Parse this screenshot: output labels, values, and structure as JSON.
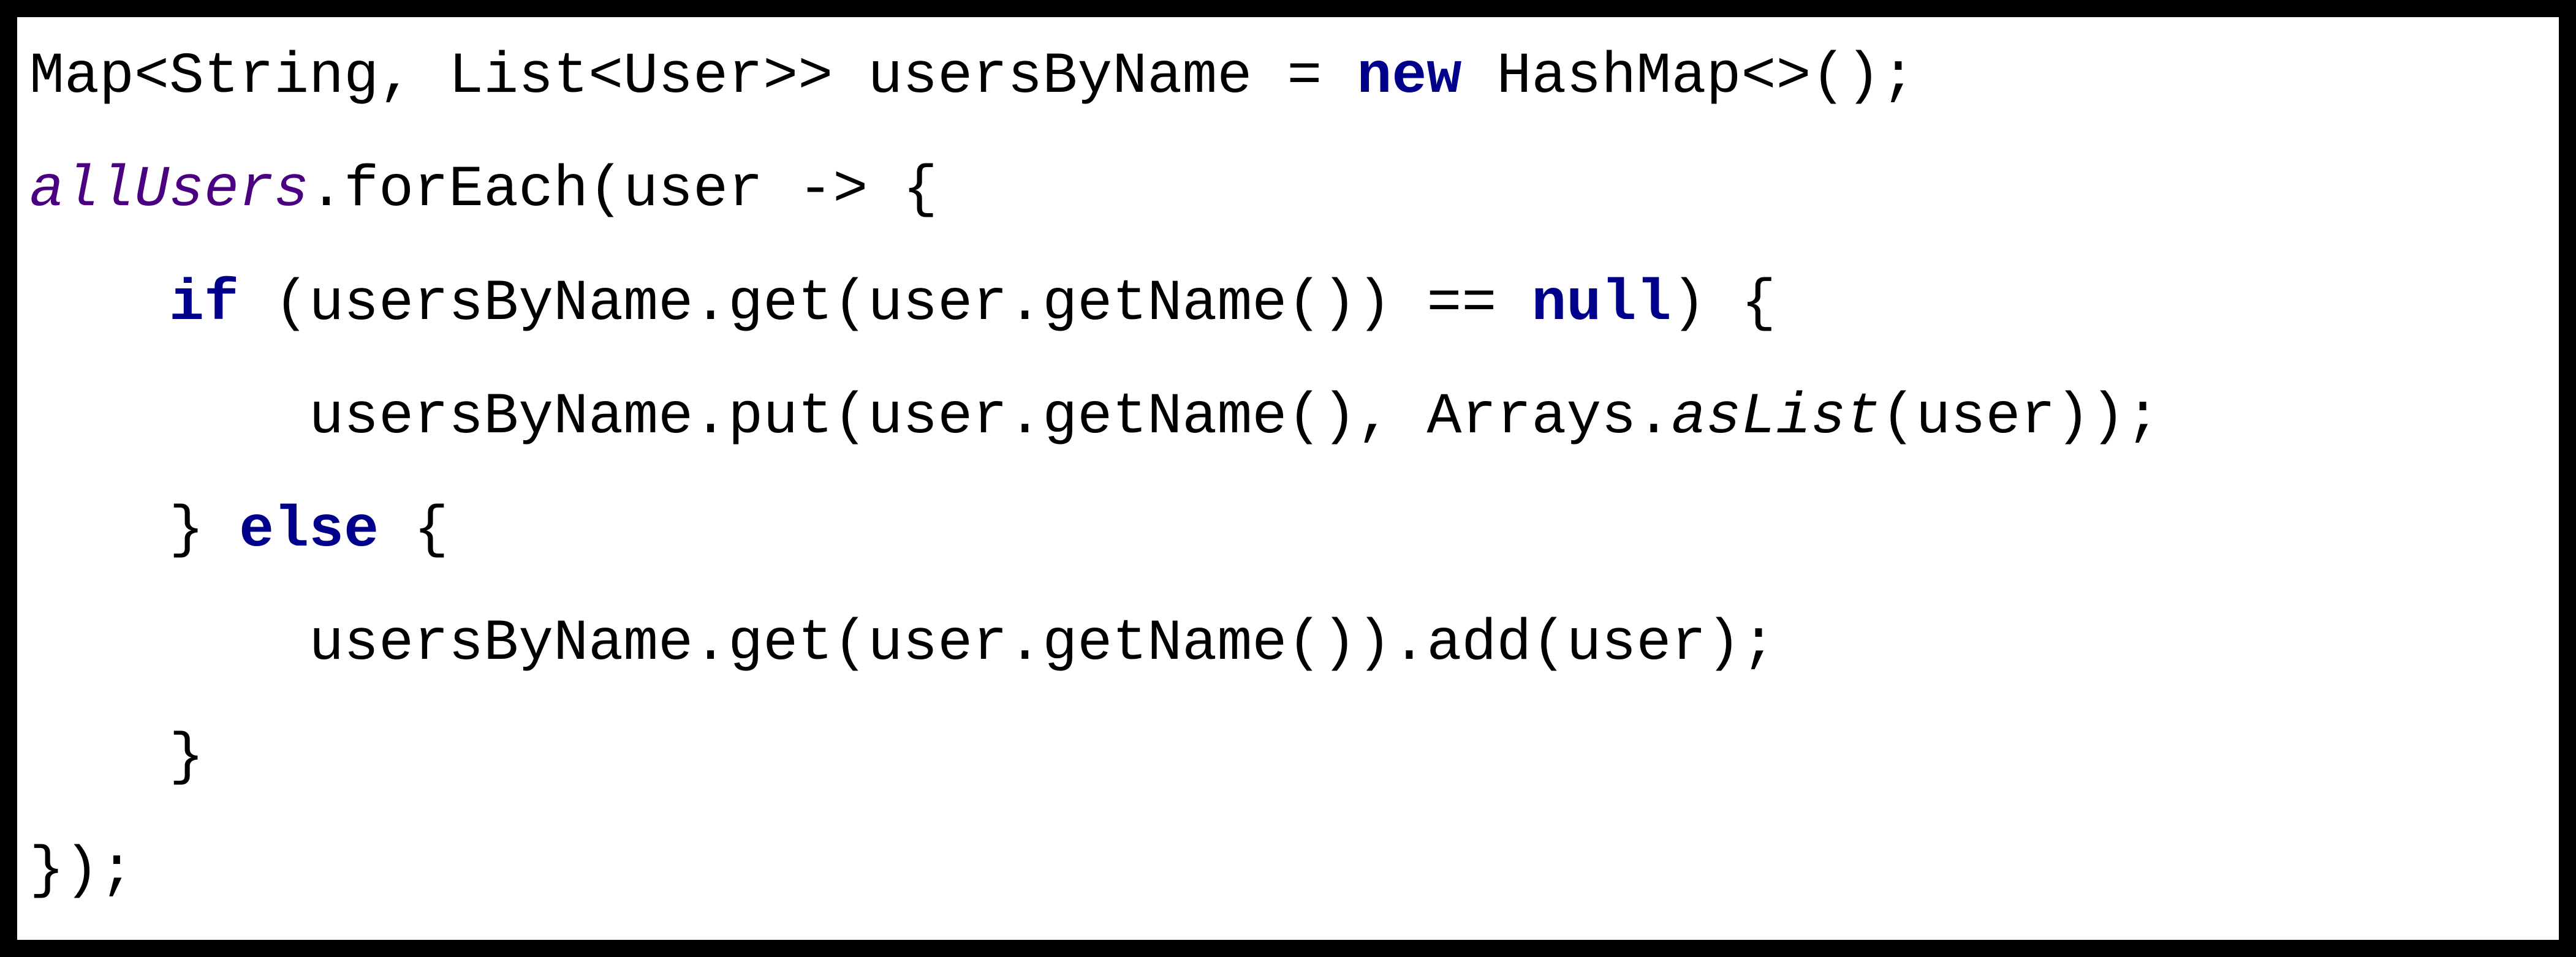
{
  "code": {
    "line1": {
      "t1": "Map<String, List<User>> usersByName = ",
      "kw_new": "new",
      "t2": " HashMap<>();"
    },
    "line2": {
      "var": "allUsers",
      "t1": ".forEach(user -> {"
    },
    "line3": {
      "indent": "    ",
      "kw_if": "if",
      "t1": " (usersByName.get(user.getName()) == ",
      "kw_null": "null",
      "t2": ") {"
    },
    "line4": {
      "indent": "        ",
      "t1": "usersByName.put(user.getName(), Arrays.",
      "static": "asList",
      "t2": "(user));"
    },
    "line5": {
      "indent": "    ",
      "t1": "} ",
      "kw_else": "else",
      "t2": " {"
    },
    "line6": {
      "indent": "        ",
      "t1": "usersByName.get(user.getName()).add(user);"
    },
    "line7": {
      "indent": "    ",
      "t1": "}"
    },
    "line8": {
      "t1": "});"
    }
  }
}
